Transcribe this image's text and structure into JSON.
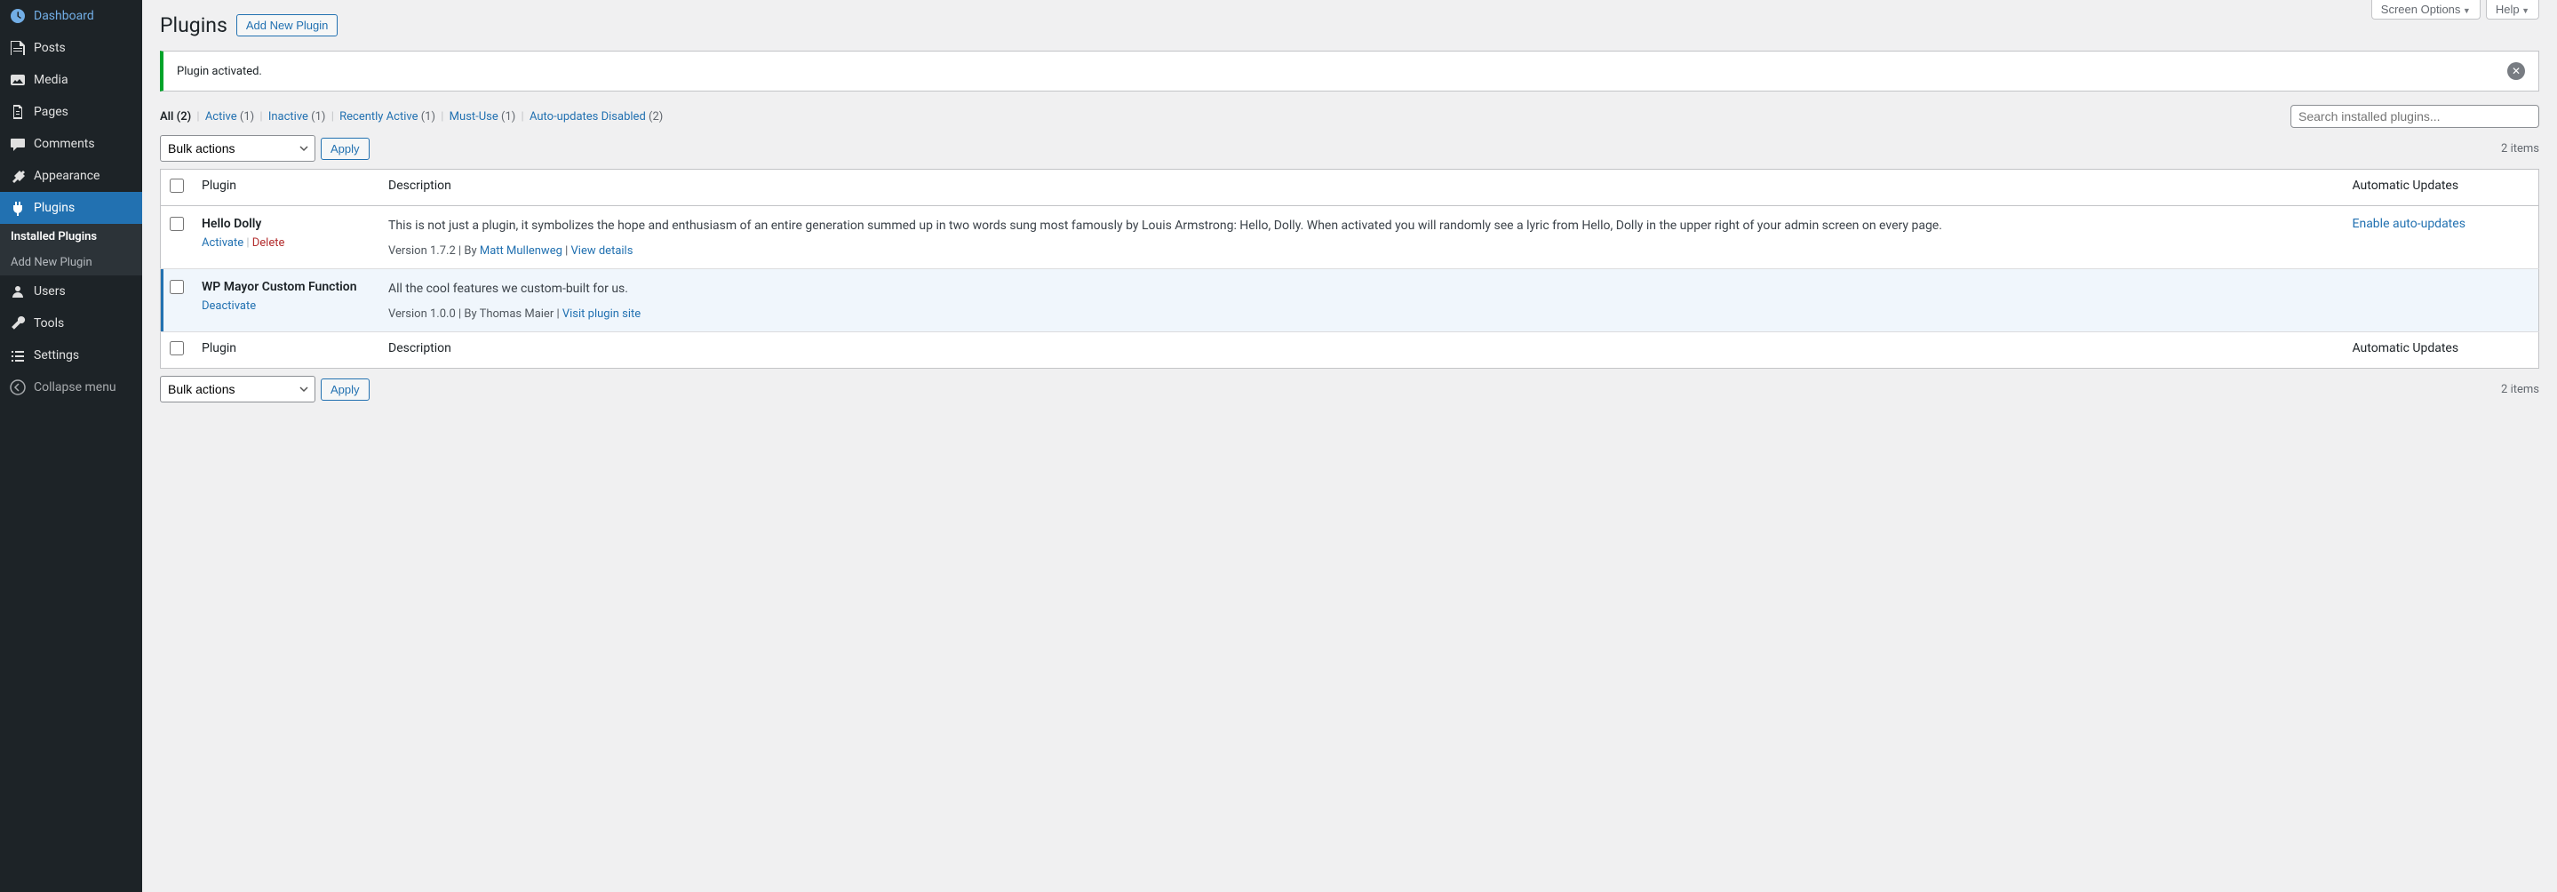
{
  "screen_meta": {
    "screen_options": "Screen Options",
    "help": "Help"
  },
  "sidebar": {
    "items": [
      {
        "id": "dashboard",
        "label": "Dashboard"
      },
      {
        "id": "posts",
        "label": "Posts"
      },
      {
        "id": "media",
        "label": "Media"
      },
      {
        "id": "pages",
        "label": "Pages"
      },
      {
        "id": "comments",
        "label": "Comments"
      },
      {
        "id": "appearance",
        "label": "Appearance"
      },
      {
        "id": "plugins",
        "label": "Plugins"
      },
      {
        "id": "users",
        "label": "Users"
      },
      {
        "id": "tools",
        "label": "Tools"
      },
      {
        "id": "settings",
        "label": "Settings"
      },
      {
        "id": "collapse",
        "label": "Collapse menu"
      }
    ],
    "sub": {
      "installed": "Installed Plugins",
      "addnew": "Add New Plugin"
    }
  },
  "header": {
    "title": "Plugins",
    "add_new": "Add New Plugin"
  },
  "notice": {
    "message": "Plugin activated."
  },
  "filters": {
    "all": {
      "label": "All",
      "count": "(2)"
    },
    "active": {
      "label": "Active",
      "count": "(1)"
    },
    "inactive": {
      "label": "Inactive",
      "count": "(1)"
    },
    "recently_active": {
      "label": "Recently Active",
      "count": "(1)"
    },
    "must_use": {
      "label": "Must-Use",
      "count": "(1)"
    },
    "auto_disabled": {
      "label": "Auto-updates Disabled",
      "count": "(2)"
    }
  },
  "search": {
    "placeholder": "Search installed plugins..."
  },
  "bulk": {
    "label": "Bulk actions",
    "apply": "Apply"
  },
  "item_count": "2 items",
  "table": {
    "headers": {
      "plugin": "Plugin",
      "description": "Description",
      "auto_updates": "Automatic Updates"
    },
    "rows": [
      {
        "active": false,
        "name": "Hello Dolly",
        "actions": [
          {
            "label": "Activate",
            "class": ""
          },
          {
            "label": "Delete",
            "class": "delete"
          }
        ],
        "description": "This is not just a plugin, it symbolizes the hope and enthusiasm of an entire generation summed up in two words sung most famously by Louis Armstrong: Hello, Dolly. When activated you will randomly see a lyric from Hello, Dolly in the upper right of your admin screen on every page.",
        "version": "Version 1.7.2",
        "by_prefix": "By ",
        "author": "Matt Mullenweg",
        "detail_link": "View details",
        "auto_update": "Enable auto-updates"
      },
      {
        "active": true,
        "name": "WP Mayor Custom Function",
        "actions": [
          {
            "label": "Deactivate",
            "class": ""
          }
        ],
        "description": "All the cool features we custom-built for us.",
        "version": "Version 1.0.0",
        "by_prefix": "By Thomas Maier",
        "author": "",
        "detail_link": "Visit plugin site",
        "auto_update": ""
      }
    ]
  }
}
